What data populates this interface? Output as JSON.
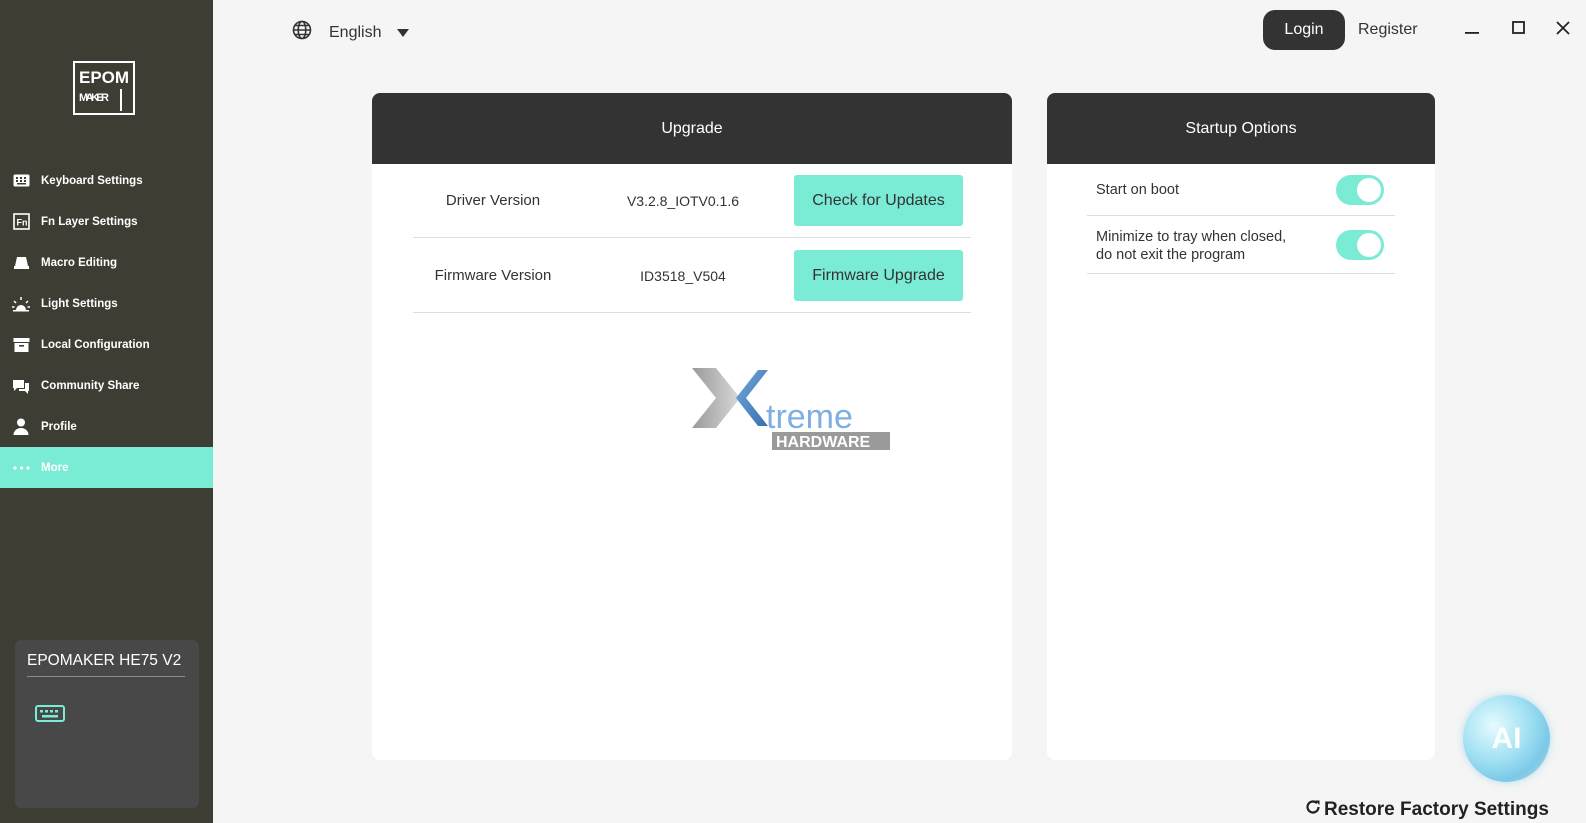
{
  "app": {
    "language": "English",
    "login_label": "Login",
    "register_label": "Register",
    "accent_color": "#7aebd5"
  },
  "sidebar": {
    "logo_text": "EPOMAKER",
    "items": [
      {
        "label": "Keyboard Settings",
        "icon": "keyboard-icon"
      },
      {
        "label": "Fn Layer Settings",
        "icon": "fn-icon"
      },
      {
        "label": "Macro Editing",
        "icon": "macro-icon"
      },
      {
        "label": "Light Settings",
        "icon": "light-icon"
      },
      {
        "label": "Local Configuration",
        "icon": "archive-icon"
      },
      {
        "label": "Community Share",
        "icon": "chat-icon"
      },
      {
        "label": "Profile",
        "icon": "user-icon"
      },
      {
        "label": "More",
        "icon": "dots-icon",
        "active": true
      }
    ],
    "device": {
      "name": "EPOMAKER HE75 V2",
      "icon": "keyboard-icon"
    }
  },
  "upgrade": {
    "title": "Upgrade",
    "rows": [
      {
        "label": "Driver Version",
        "value": "V3.2.8_IOTV0.1.6",
        "button": "Check for Updates"
      },
      {
        "label": "Firmware Version",
        "value": "ID3518_V504",
        "button": "Firmware Upgrade"
      }
    ],
    "watermark": {
      "word": "treme",
      "sub": "HARDWARE"
    }
  },
  "startup": {
    "title": "Startup Options",
    "options": [
      {
        "label": "Start on boot",
        "enabled": true
      },
      {
        "label_line1": "Minimize to tray when closed,",
        "label_line2": "do not exit the program",
        "enabled": true
      }
    ]
  },
  "ai_label": "AI",
  "restore_label": "Restore Factory Settings"
}
